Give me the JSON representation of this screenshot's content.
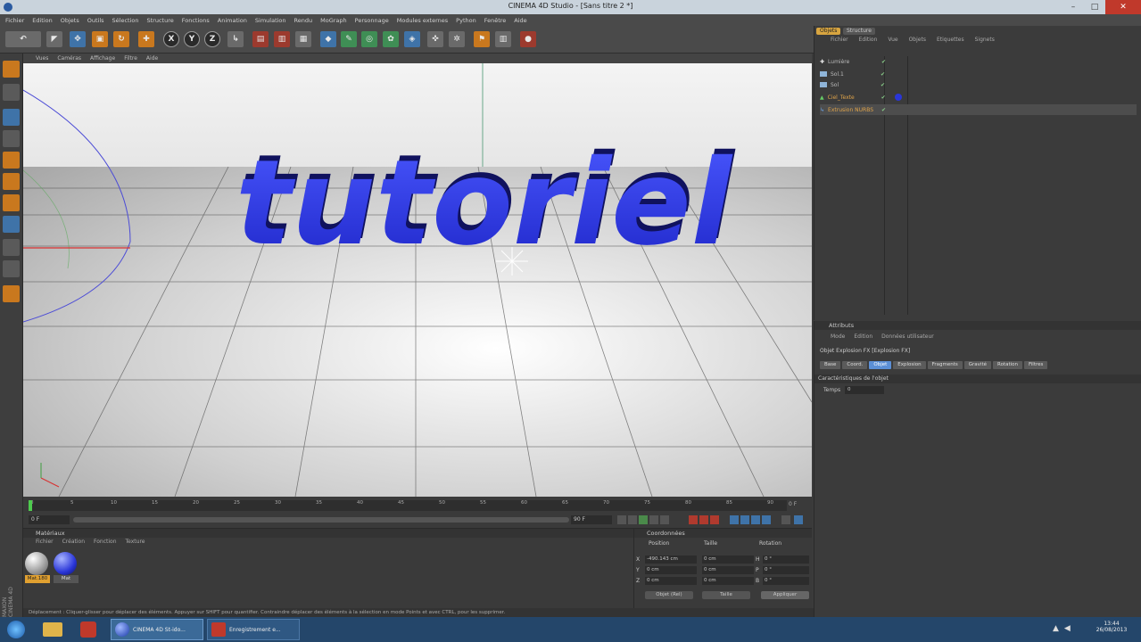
{
  "window": {
    "title": "CINEMA 4D Studio - [Sans titre 2 *]",
    "controls": [
      "–",
      "□",
      "✕"
    ]
  },
  "menu": [
    "Fichier",
    "Edition",
    "Objets",
    "Outils",
    "Sélection",
    "Structure",
    "Fonctions",
    "Animation",
    "Simulation",
    "Rendu",
    "MoGraph",
    "Personnage",
    "Modules externes",
    "Python",
    "Fenêtre",
    "Aide"
  ],
  "toolbar": {
    "axis_x": "X",
    "axis_y": "Y",
    "axis_z": "Z"
  },
  "viewport": {
    "menu": [
      "Vues",
      "Caméras",
      "Affichage",
      "Filtre",
      "Aide"
    ],
    "scene_text": "tutoriel"
  },
  "timeline": {
    "ticks": [
      "0",
      "5",
      "10",
      "15",
      "20",
      "25",
      "30",
      "35",
      "40",
      "45",
      "50",
      "55",
      "60",
      "65",
      "70",
      "75",
      "80",
      "85",
      "90"
    ],
    "frame_end_label": "0 F",
    "start": "0 F",
    "end": "90 F"
  },
  "materials": {
    "title": "Matériaux",
    "menu": [
      "Fichier",
      "Création",
      "Fonction",
      "Texture"
    ],
    "items": [
      {
        "label": "Mat.180"
      },
      {
        "label": "Mat"
      }
    ]
  },
  "coords": {
    "title": "Coordonnées",
    "headers": [
      "Position",
      "Taille",
      "Rotation"
    ],
    "rows": [
      {
        "axis": "X",
        "pos": "-490.143 cm",
        "size": "0 cm",
        "rotlabel": "H",
        "rot": "0 °"
      },
      {
        "axis": "Y",
        "pos": "0 cm",
        "size": "0 cm",
        "rotlabel": "P",
        "rot": "0 °"
      },
      {
        "axis": "Z",
        "pos": "0 cm",
        "size": "0 cm",
        "rotlabel": "B",
        "rot": "0 °"
      }
    ],
    "mode_select": "Objet (Rel)",
    "size_select": "Taille",
    "apply": "Appliquer"
  },
  "status": "Déplacement : Cliquer-glisser pour déplacer des éléments. Appuyer sur SHIFT pour quantifier. Contraindre déplacer des éléments à la sélection en mode Points et avec CTRL, pour les supprimer.",
  "objects_panel": {
    "tabs": [
      "Objets",
      "Structure"
    ],
    "menu": [
      "Fichier",
      "Edition",
      "Vue",
      "Objets",
      "Etiquettes",
      "Signets"
    ],
    "rows": [
      {
        "name": "Lumière",
        "color": "#bdbdbd"
      },
      {
        "name": "Sol.1",
        "color": "#bdbdbd"
      },
      {
        "name": "Sol",
        "color": "#bdbdbd"
      },
      {
        "name": "Ciel_Texte",
        "color": "#e0a44a"
      },
      {
        "name": "Extrusion NURBS",
        "color": "#e0a44a"
      }
    ]
  },
  "attributes_panel": {
    "title": "Attributs",
    "menu": [
      "Mode",
      "Edition",
      "Données utilisateur"
    ],
    "object_label": "Objet Explosion FX [Explosion FX]",
    "tabs": [
      "Base",
      "Coord.",
      "Objet",
      "Explosion",
      "Fragments",
      "Gravité",
      "Rotation",
      "Filtres"
    ],
    "section": "Caractéristiques de l'objet",
    "field_label": "Temps",
    "field_value": "0"
  },
  "taskbar": {
    "items": [
      {
        "label": "CINEMA 4D St-ido..."
      },
      {
        "label": "Enregistrement e..."
      }
    ],
    "time": "13:44",
    "date": "26/08/2013"
  },
  "side_label": "MAXON CINEMA 4D",
  "colors": {
    "accent": "#c9781e",
    "text_blue": "#2f3ee0",
    "selected_tab": "#5b8fd6"
  }
}
